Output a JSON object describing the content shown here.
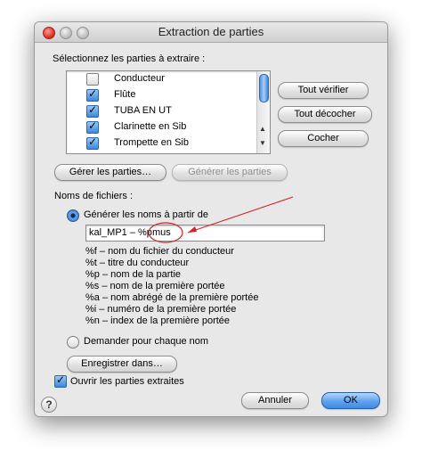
{
  "window": {
    "title": "Extraction de parties"
  },
  "parts_section": {
    "label": "Sélectionnez les parties à extraire :",
    "items": [
      {
        "label": "Conducteur",
        "checked": false
      },
      {
        "label": "Flûte",
        "checked": true
      },
      {
        "label": "TUBA EN UT",
        "checked": true
      },
      {
        "label": "Clarinette en Sib",
        "checked": true
      },
      {
        "label": "Trompette en Sib",
        "checked": true
      }
    ]
  },
  "side_buttons": {
    "check_all": "Tout vérifier",
    "uncheck_all": "Tout décocher",
    "check": "Cocher"
  },
  "manage_buttons": {
    "manage": "Gérer les parties…",
    "generate": "Générer les parties"
  },
  "filenames": {
    "label": "Noms de fichiers :",
    "generate_option": "Générer les noms à partir de",
    "pattern_value_prefix": "kal_MP1 – %p",
    "pattern_value_highlight": "mus",
    "tokens": [
      "%f – nom du fichier du conducteur",
      "%t – titre du conducteur",
      "%p – nom de la partie",
      "%s – nom de la première portée",
      "%a – nom abrégé de la première portée",
      "%i – numéro de la première portée",
      "%n – index de la première portée"
    ],
    "ask_option": "Demander pour chaque nom"
  },
  "save_button": "Enregistrer dans…",
  "open_checkbox": {
    "label": "Ouvrir les parties extraites",
    "checked": true
  },
  "footer": {
    "cancel": "Annuler",
    "ok": "OK",
    "help": "?"
  },
  "colors": {
    "annotation_red": "#d42020",
    "accent_blue": "#3f8ae2"
  }
}
